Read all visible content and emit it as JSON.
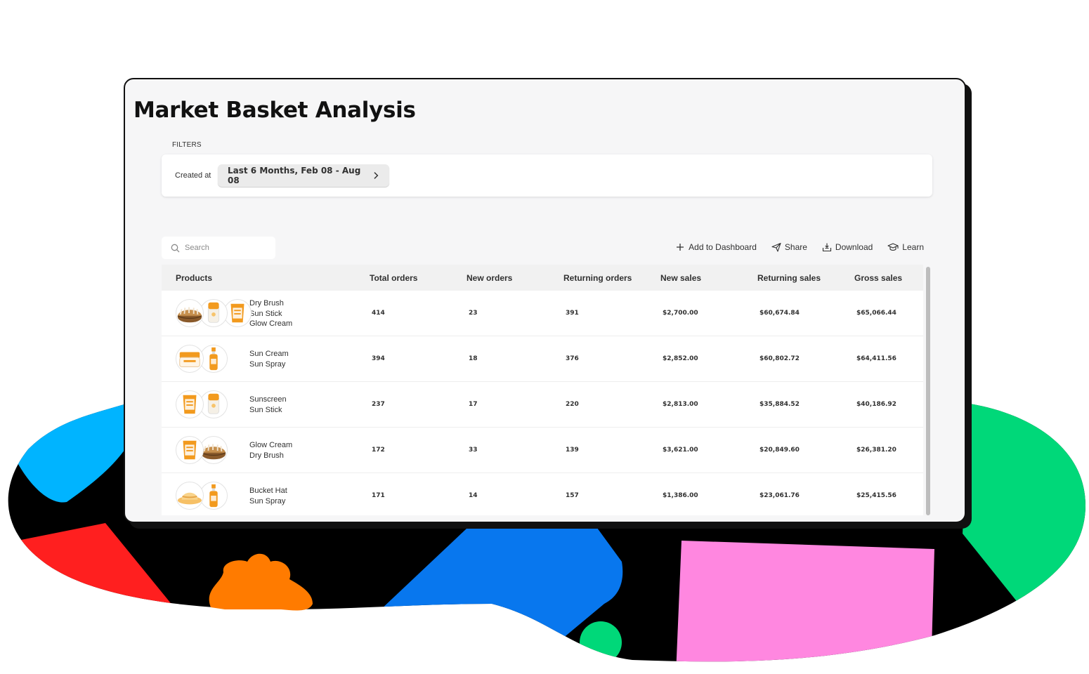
{
  "page": {
    "title": "Market Basket Analysis",
    "filters_label": "FILTERS",
    "filter": {
      "key": "Created at",
      "value": "Last 6 Months, Feb 08 - Aug 08"
    }
  },
  "search": {
    "placeholder": "Search"
  },
  "toolbar": {
    "add_to_dashboard": "Add to Dashboard",
    "share": "Share",
    "download": "Download",
    "learn": "Learn"
  },
  "table": {
    "headers": {
      "products": "Products",
      "total_orders": "Total orders",
      "new_orders": "New orders",
      "returning_orders": "Returning orders",
      "new_sales": "New sales",
      "returning_sales": "Returning sales",
      "gross_sales": "Gross sales"
    },
    "rows": [
      {
        "products": [
          "Dry Brush",
          "Sun Stick",
          "Glow Cream"
        ],
        "thumbs": [
          "brush-icon",
          "stick-icon",
          "cream-tube-icon"
        ],
        "total_orders": "414",
        "new_orders": "23",
        "returning_orders": "391",
        "new_sales": "$2,700.00",
        "returning_sales": "$60,674.84",
        "gross_sales": "$65,066.44"
      },
      {
        "products": [
          "Sun Cream",
          "Sun Spray"
        ],
        "thumbs": [
          "jar-icon",
          "spray-icon"
        ],
        "total_orders": "394",
        "new_orders": "18",
        "returning_orders": "376",
        "new_sales": "$2,852.00",
        "returning_sales": "$60,802.72",
        "gross_sales": "$64,411.56"
      },
      {
        "products": [
          "Sunscreen",
          "Sun Stick"
        ],
        "thumbs": [
          "cream-tube-icon",
          "stick-icon"
        ],
        "total_orders": "237",
        "new_orders": "17",
        "returning_orders": "220",
        "new_sales": "$2,813.00",
        "returning_sales": "$35,884.52",
        "gross_sales": "$40,186.92"
      },
      {
        "products": [
          "Glow Cream",
          "Dry Brush"
        ],
        "thumbs": [
          "cream-tube-icon",
          "brush-icon"
        ],
        "total_orders": "172",
        "new_orders": "33",
        "returning_orders": "139",
        "new_sales": "$3,621.00",
        "returning_sales": "$20,849.60",
        "gross_sales": "$26,381.20"
      },
      {
        "products": [
          "Bucket Hat",
          "Sun Spray"
        ],
        "thumbs": [
          "hat-icon",
          "spray-icon"
        ],
        "total_orders": "171",
        "new_orders": "14",
        "returning_orders": "157",
        "new_sales": "$1,386.00",
        "returning_sales": "$23,061.76",
        "gross_sales": "$25,415.56"
      }
    ]
  },
  "colors": {
    "product_orange": "#f29a1e",
    "product_tan": "#b5742f",
    "background_blob": "#000000",
    "blob_blue": "#00b4ff",
    "blob_red": "#ff1f1f",
    "blob_royal_blue": "#0877ee",
    "blob_orange": "#ff7b00",
    "blob_green": "#00d879",
    "blob_pink": "#ff87e0"
  }
}
